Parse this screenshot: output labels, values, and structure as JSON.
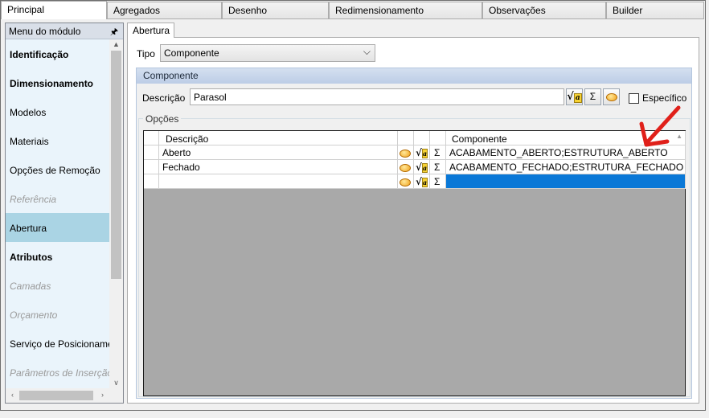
{
  "top_tabs": [
    "Principal",
    "Agregados",
    "Desenho",
    "Redimensionamento",
    "Observações",
    "Builder"
  ],
  "left_panel": {
    "header": "Menu do módulo",
    "items": [
      {
        "label": "Identificação",
        "style": "bold"
      },
      {
        "label": "Dimensionamento",
        "style": "bold"
      },
      {
        "label": "Modelos",
        "style": "normal"
      },
      {
        "label": "Materiais",
        "style": "normal"
      },
      {
        "label": "Opções de Remoção",
        "style": "normal"
      },
      {
        "label": "Referência",
        "style": "disabled"
      },
      {
        "label": "Abertura",
        "style": "selected"
      },
      {
        "label": "Atributos",
        "style": "bold"
      },
      {
        "label": "Camadas",
        "style": "disabled"
      },
      {
        "label": "Orçamento",
        "style": "disabled"
      },
      {
        "label": "Serviço de Posicionamen",
        "style": "normal"
      },
      {
        "label": "Parâmetros de Inserção",
        "style": "disabled"
      }
    ]
  },
  "inner_tab": "Abertura",
  "tipo": {
    "label": "Tipo",
    "value": "Componente"
  },
  "componente_group": {
    "title": "Componente",
    "descricao_label": "Descrição",
    "descricao_value": "Parasol",
    "especifico_label": "Específico",
    "sigma": "Σ"
  },
  "opcoes": {
    "label": "Opções",
    "columns": [
      "Descrição",
      "Componente"
    ],
    "rows": [
      {
        "descricao": "Aberto",
        "componente": "ACABAMENTO_ABERTO;ESTRUTURA_ABERTO"
      },
      {
        "descricao": "Fechado",
        "componente": "ACABAMENTO_FECHADO;ESTRUTURA_FECHADO"
      },
      {
        "descricao": "",
        "componente": ""
      }
    ]
  },
  "colors": {
    "selected_cell": "#0a78d7",
    "selected_menu": "#aad4e4",
    "arrow": "#e0201a"
  }
}
